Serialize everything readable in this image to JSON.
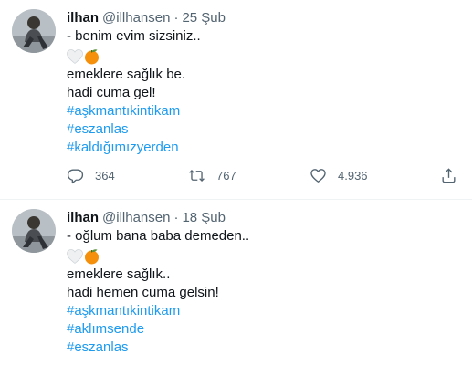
{
  "tweets": [
    {
      "author_name": "ilhan",
      "handle": "@illhansen",
      "separator": "·",
      "date": "25 Şub",
      "lines": [
        "- benim evim sizsiniz..",
        "emeklere sağlık be.",
        "hadi cuma gel!"
      ],
      "hashtags": [
        "#aşkmantıkintikam",
        "#eszanlas",
        "#kaldığımızyerden"
      ],
      "reply_count": "364",
      "retweet_count": "767",
      "like_count": "4.936"
    },
    {
      "author_name": "ilhan",
      "handle": "@illhansen",
      "separator": "·",
      "date": "18 Şub",
      "lines": [
        "- oğlum bana baba demeden..",
        "emeklere sağlık..",
        "hadi hemen cuma gelsin!"
      ],
      "hashtags": [
        "#aşkmantıkintikam",
        "#aklımsende",
        "#eszanlas"
      ]
    }
  ],
  "emojis": [
    "white-heart-icon",
    "orange-icon"
  ],
  "colors": {
    "hashtag": "#1d9bf0",
    "secondary_text": "#536471",
    "primary_text": "#0f1419",
    "divider": "#eff3f4"
  }
}
